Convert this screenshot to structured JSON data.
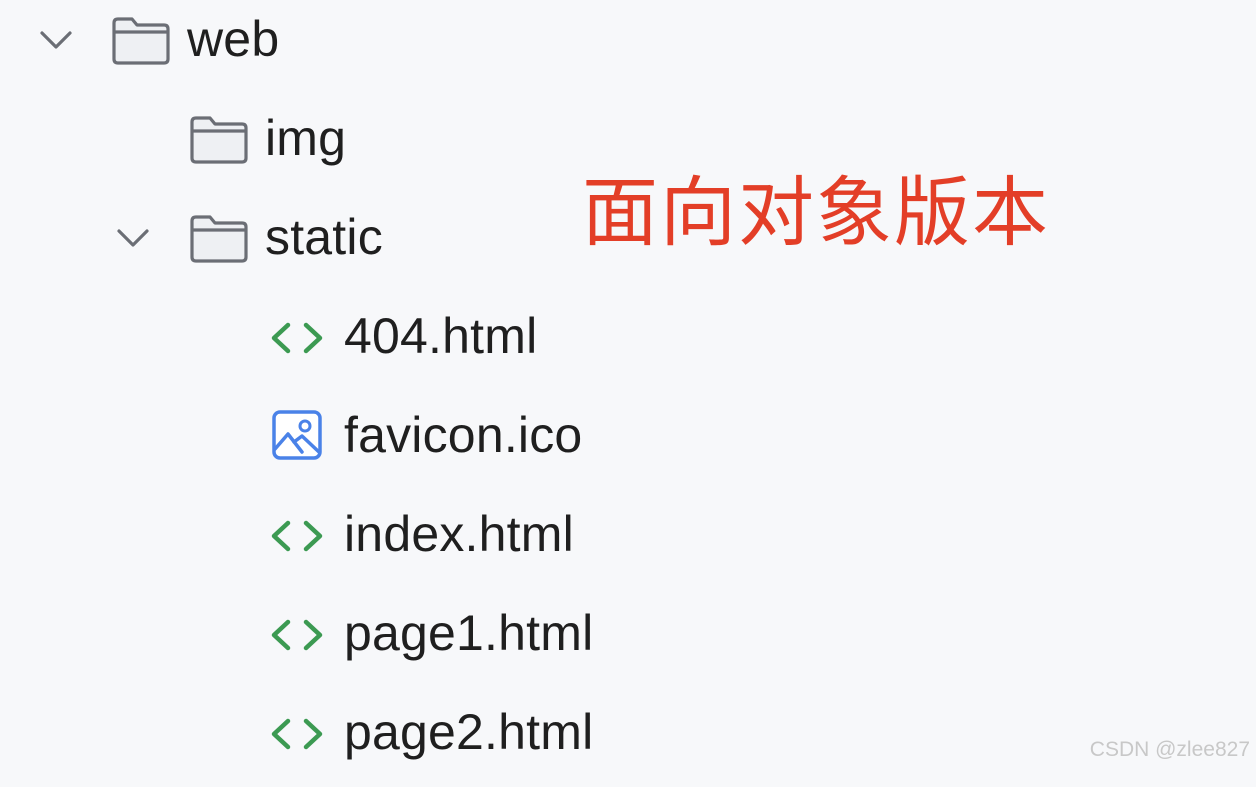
{
  "tree": {
    "web": {
      "label": "web",
      "icon": "folder-icon",
      "expanded": true
    },
    "img": {
      "label": "img",
      "icon": "folder-icon"
    },
    "static": {
      "label": "static",
      "icon": "folder-icon",
      "expanded": true
    },
    "files": [
      {
        "label": "404.html",
        "icon": "html-file-icon"
      },
      {
        "label": "favicon.ico",
        "icon": "image-file-icon"
      },
      {
        "label": "index.html",
        "icon": "html-file-icon"
      },
      {
        "label": "page1.html",
        "icon": "html-file-icon"
      },
      {
        "label": "page2.html",
        "icon": "html-file-icon"
      }
    ]
  },
  "annotation": {
    "text": "面向对象版本",
    "color": "#e33e27"
  },
  "watermark": {
    "text": "CSDN @zlee827"
  },
  "colors": {
    "html_icon": "#3c9a52",
    "image_icon": "#4a82e8",
    "folder_stroke": "#6b6e75"
  }
}
